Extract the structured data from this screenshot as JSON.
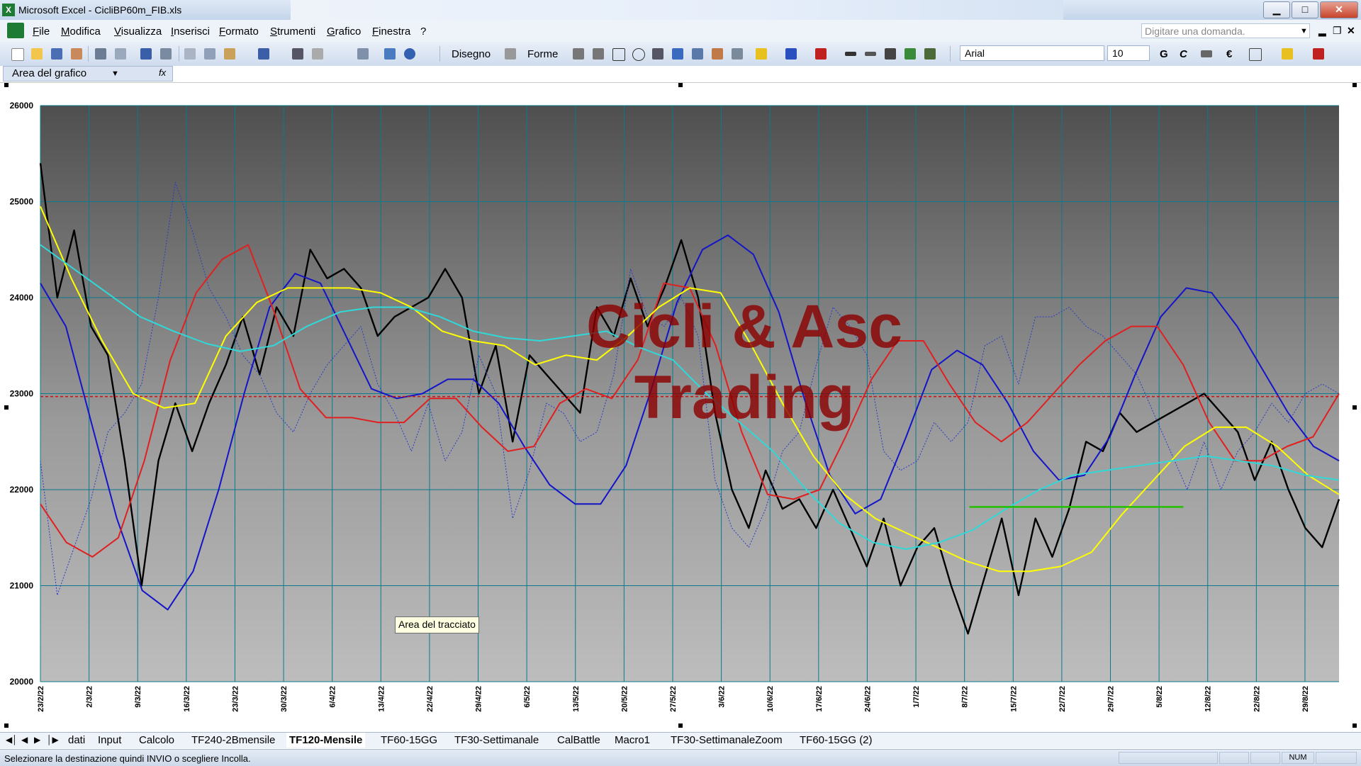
{
  "window": {
    "title": "Microsoft Excel - CicliBP60m_FIB.xls",
    "app_icon": "X",
    "min": "▁",
    "max": "□",
    "close": "✕"
  },
  "menu": {
    "items": [
      "File",
      "Modifica",
      "Visualizza",
      "Inserisci",
      "Formato",
      "Strumenti",
      "Grafico",
      "Finestra",
      "?"
    ],
    "question_placeholder": "Digitare una domanda."
  },
  "toolbar": {
    "draw_label": "Disegno",
    "shapes_label": "Forme",
    "font": "Arial",
    "font_size": "10",
    "bold": "G",
    "italic": "C",
    "euro": "€"
  },
  "formula_bar": {
    "name_box": "Area del grafico",
    "fx": "fx"
  },
  "tooltip": {
    "text": "Area del tracciato"
  },
  "sheets": {
    "tabs": [
      "dati",
      "Input",
      "Calcolo",
      "TF240-2Bmensile",
      "TF120-Mensile",
      "TF60-15GG",
      "TF30-Settimanale",
      "CalBattle",
      "Macro1",
      "TF30-SettimanaleZoom",
      "TF60-15GG (2)"
    ],
    "active": "TF120-Mensile"
  },
  "status": {
    "message": "Selezionare la destinazione quindi INVIO o scegliere Incolla.",
    "num": "NUM"
  },
  "chart_data": {
    "type": "line",
    "watermark": [
      "Cicli & Asc",
      "Trading"
    ],
    "ylim": [
      20000,
      26000
    ],
    "y_ticks": [
      "26000",
      "25000",
      "24000",
      "23000",
      "22000",
      "21000",
      "20000"
    ],
    "x_ticks": [
      "23/2/22",
      "2/3/22",
      "9/3/22",
      "16/3/22",
      "23/3/22",
      "30/3/22",
      "6/4/22",
      "13/4/22",
      "22/4/22",
      "29/4/22",
      "6/5/22",
      "13/5/22",
      "20/5/22",
      "27/5/22",
      "3/6/22",
      "10/6/22",
      "17/6/22",
      "24/6/22",
      "1/7/22",
      "8/7/22",
      "15/7/22",
      "22/7/22",
      "29/7/22",
      "5/8/22",
      "12/8/22",
      "22/8/22",
      "29/8/22"
    ],
    "reference_line": {
      "value": 22970,
      "color": "#d01010"
    },
    "short_level": {
      "value": 21820,
      "from": 19.1,
      "to": 23.5,
      "color": "#22c000"
    },
    "grid": true,
    "colors": {
      "price": "#000000",
      "dotted": "#2a3cc8",
      "blue": "#1414c8",
      "red": "#e02020",
      "yellow": "#ffff00",
      "cyan": "#30d8d8"
    },
    "series": [
      {
        "values": [
          25400,
          24000,
          24700,
          23700,
          23400,
          22300,
          21000,
          22300,
          22900,
          22400,
          22900,
          23300,
          23800,
          23200,
          23900,
          23600,
          24500,
          24200,
          24300,
          24100,
          23600,
          23800,
          23900,
          24000,
          24300,
          24000,
          23000,
          23500,
          22500,
          23400,
          23200,
          23000,
          22800,
          23900,
          23600,
          24200,
          23700,
          24100,
          24600,
          24000,
          22800,
          22000,
          21600,
          22200,
          21800,
          21900,
          21600,
          22000,
          21600,
          21200,
          21700,
          21000,
          21400,
          21600,
          21000,
          20500,
          21100,
          21700,
          20900,
          21700,
          21300,
          21800,
          22500,
          22400,
          22800,
          22600,
          22700,
          22800,
          22900,
          23000,
          22800,
          22600,
          22100,
          22500,
          22000,
          21600,
          21400,
          21900
        ]
      },
      {
        "values": [
          22300,
          20900,
          21400,
          21900,
          22600,
          22800,
          23100,
          24000,
          25200,
          24700,
          24100,
          23800,
          23400,
          23200,
          22800,
          22600,
          23000,
          23300,
          23500,
          23700,
          23100,
          22800,
          22400,
          22900,
          22300,
          22600,
          23400,
          23000,
          21700,
          22200,
          22900,
          22800,
          22500,
          22600,
          23200,
          24300,
          23800,
          23700,
          24000,
          23600,
          22100,
          21600,
          21400,
          21800,
          22400,
          22600,
          23300,
          23900,
          23700,
          23400,
          22400,
          22200,
          22300,
          22700,
          22500,
          22700,
          23500,
          23600,
          23100,
          23800,
          23800,
          23900,
          23700,
          23600,
          23400,
          23200,
          22800,
          22400,
          22000,
          22500,
          22000,
          22400,
          22600,
          22900,
          22700,
          23000,
          23100,
          23000
        ]
      },
      {
        "values": [
          24150,
          23700,
          22700,
          21700,
          20950,
          20750,
          21150,
          22000,
          23000,
          23900,
          24250,
          24150,
          23600,
          23050,
          22950,
          23000,
          23150,
          23150,
          22900,
          22450,
          22050,
          21850,
          21850,
          22250,
          23050,
          23950,
          24500,
          24650,
          24450,
          23850,
          22950,
          22150,
          21750,
          21900,
          22550,
          23250,
          23450,
          23300,
          22900,
          22400,
          22100,
          22150,
          22550,
          23200,
          23800,
          24100,
          24050,
          23700,
          23250,
          22800,
          22450,
          22300
        ]
      },
      {
        "values": [
          21850,
          21450,
          21300,
          21500,
          22300,
          23350,
          24050,
          24400,
          24550,
          23850,
          23050,
          22750,
          22750,
          22700,
          22700,
          22950,
          22950,
          22650,
          22400,
          22450,
          22900,
          23050,
          22950,
          23350,
          24150,
          24100,
          23500,
          22600,
          21950,
          21900,
          22000,
          22550,
          23150,
          23550,
          23550,
          23100,
          22700,
          22500,
          22700,
          23000,
          23300,
          23550,
          23700,
          23700,
          23300,
          22700,
          22300,
          22300,
          22450,
          22550,
          23000
        ]
      },
      {
        "values": [
          24950,
          24200,
          23550,
          23000,
          22850,
          22900,
          23600,
          23950,
          24100,
          24100,
          24100,
          24050,
          23900,
          23650,
          23550,
          23500,
          23300,
          23400,
          23350,
          23600,
          23900,
          24100,
          24050,
          23500,
          22900,
          22350,
          21950,
          21700,
          21550,
          21400,
          21250,
          21150,
          21150,
          21200,
          21350,
          21750,
          22100,
          22450,
          22650,
          22650,
          22450,
          22150,
          21950
        ]
      },
      {
        "values": [
          24550,
          24300,
          24050,
          23800,
          23650,
          23520,
          23440,
          23500,
          23700,
          23850,
          23900,
          23900,
          23800,
          23650,
          23580,
          23550,
          23600,
          23650,
          23480,
          23350,
          23000,
          22700,
          22400,
          22000,
          21650,
          21450,
          21380,
          21450,
          21580,
          21800,
          22000,
          22150,
          22200,
          22250,
          22300,
          22350,
          22300,
          22250,
          22150,
          22100
        ]
      }
    ]
  }
}
